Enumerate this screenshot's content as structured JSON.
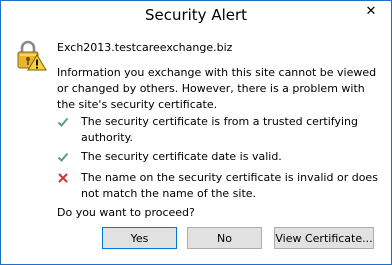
{
  "window": {
    "title": "Security Alert"
  },
  "close_glyph": "✕",
  "host": "Exch2013.testcareexchange.biz",
  "intro": "Information you exchange with this site cannot be viewed or changed by others. However, there is a problem with the site's security certificate.",
  "items": [
    {
      "status": "ok",
      "text": "The security certificate is from a trusted certifying authority."
    },
    {
      "status": "ok",
      "text": "The security certificate date is valid."
    },
    {
      "status": "error",
      "text": "The name on the security certificate is invalid or does not match the name of the site."
    }
  ],
  "question": "Do you want to proceed?",
  "buttons": {
    "yes": "Yes",
    "no": "No",
    "view": "View Certificate..."
  },
  "colors": {
    "ok": "#5a9e89",
    "error": "#d13438",
    "border": "#1d6fc4"
  },
  "icons": {
    "window_close": "close-icon",
    "alert": "lock-warning-icon",
    "ok": "checkmark-icon",
    "error": "x-mark-icon"
  }
}
